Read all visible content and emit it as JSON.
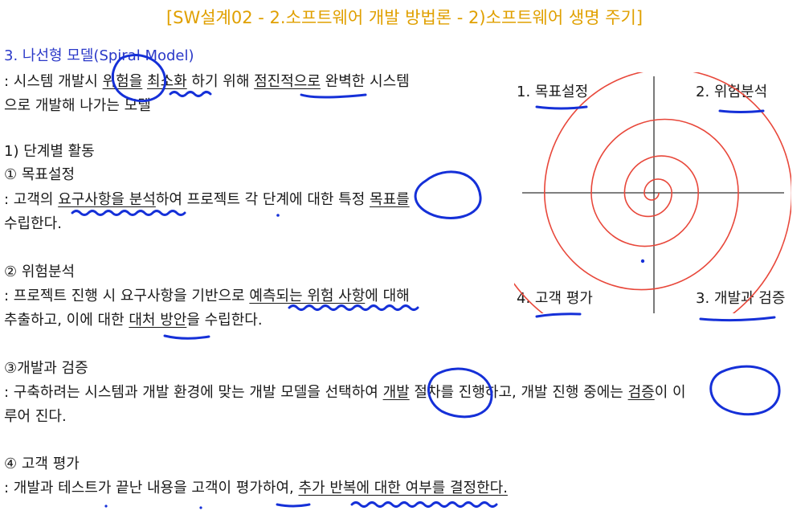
{
  "title": "[SW설계02 - 2.소프트웨어 개발 방법론 - 2)소프트웨어 생명 주기]",
  "section": {
    "heading": "3. 나선형 모델(Spiral Model)",
    "definition_part1": ": 시스템 개발시 ",
    "definition_risk": "위험을",
    "definition_part2": " ",
    "definition_minimize": "최소화",
    "definition_part3": " 하기 위해 ",
    "definition_incremental": "점진적으로",
    "definition_part4": " 완벽한 시스템",
    "definition_line2": "으로 개발해 나가는 모델"
  },
  "activities": {
    "heading": "1) 단계별 활동",
    "step1": {
      "title": "① 목표설정",
      "line1_a": ": 고객의 ",
      "line1_b": "요구사항을 분석",
      "line1_c": "하여 프로젝트 각 단계에 대한 특정 ",
      "line1_d": "목표를",
      "line2": "수립한다."
    },
    "step2": {
      "title": "② 위험분석",
      "line1_a": ": 프로젝트 진행 시 요구사항을 기반으로 ",
      "line1_b": "예측되는 위험 사항",
      "line1_c": "에 대해",
      "line2_a": "추출하고, 이에 대한 ",
      "line2_b": "대처 방안",
      "line2_c": "을 수립한다."
    },
    "step3": {
      "title": "③개발과 검증",
      "line1_a": ": 구축하려는 시스템과 개발 환경에 맞는 개발 모델을 선택하여 ",
      "line1_b": "개발",
      "line1_c": " 절차를 진행하고, 개발 진행 중에는 ",
      "line1_d": "검증",
      "line1_e": "이 이",
      "line2": "루어 진다."
    },
    "step4": {
      "title": "④ 고객 평가",
      "line1_a": ": 개발과 테스트가 끝난 내용을 고객이 평가하여, ",
      "line1_b": "추가 반복에 대한 여부를 결정한다."
    }
  },
  "diagram": {
    "q1": "1. 목표설정",
    "q2": "2. 위험분석",
    "q3": "3. 개발과 검증",
    "q4": "4. 고객 평가",
    "spiral_color": "#e8473a",
    "axis_color": "#333333"
  },
  "ink_color": "#1530d8"
}
